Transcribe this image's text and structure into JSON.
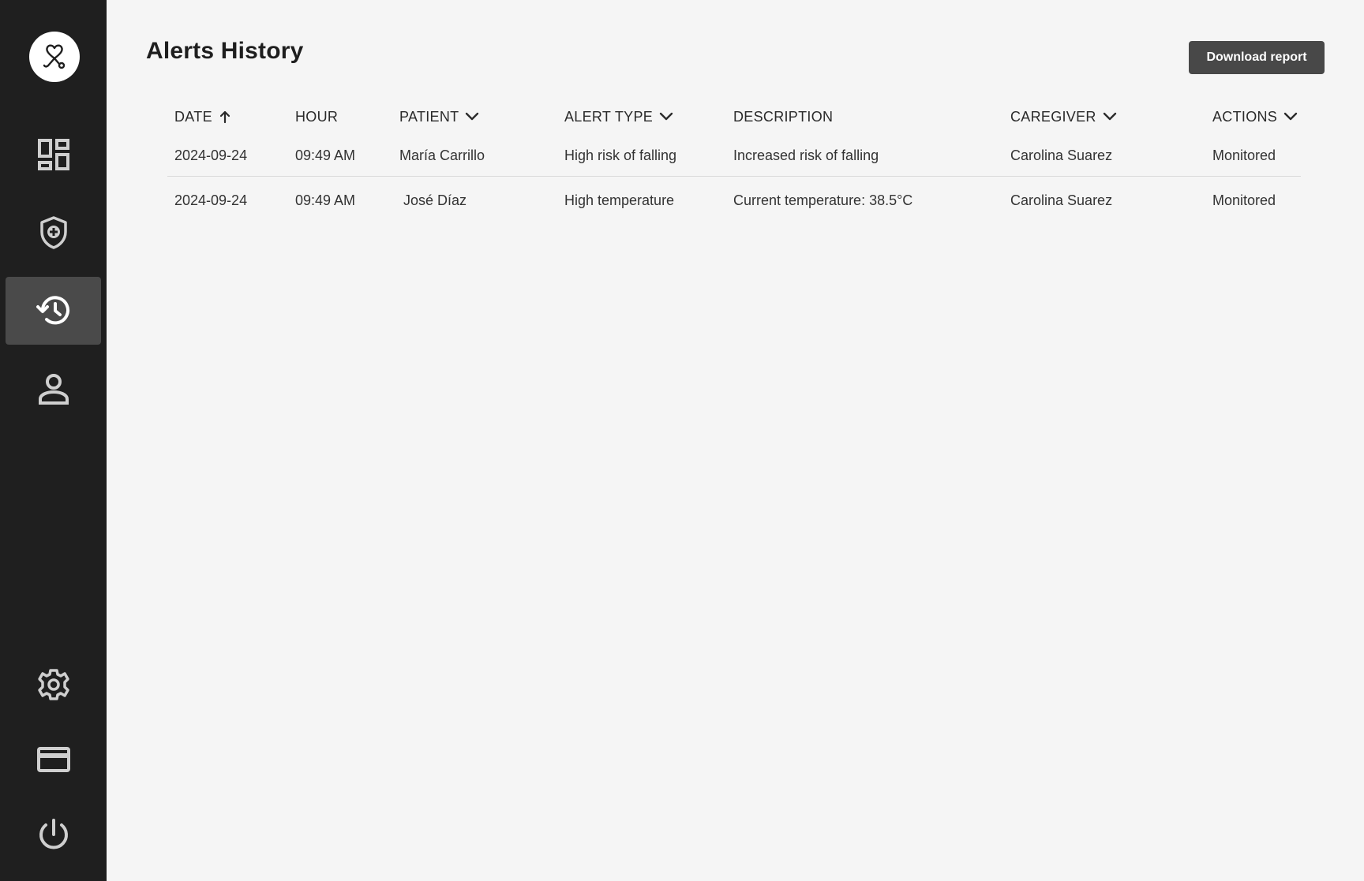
{
  "sidebar": {
    "items": [
      {
        "icon": "dashboard-icon",
        "active": false
      },
      {
        "icon": "shield-plus-icon",
        "active": false
      },
      {
        "icon": "history-icon",
        "active": true
      },
      {
        "icon": "person-icon",
        "active": false
      },
      {
        "icon": "gear-icon",
        "active": false
      },
      {
        "icon": "credit-card-icon",
        "active": false
      },
      {
        "icon": "power-icon",
        "active": false
      }
    ]
  },
  "header": {
    "title": "Alerts History",
    "download_label": "Download report"
  },
  "table": {
    "columns": [
      {
        "label": "DATE",
        "indicator": "arrow-up"
      },
      {
        "label": "HOUR",
        "indicator": "none"
      },
      {
        "label": "PATIENT",
        "indicator": "chevron-down"
      },
      {
        "label": "ALERT TYPE",
        "indicator": "chevron-down"
      },
      {
        "label": "DESCRIPTION",
        "indicator": "none"
      },
      {
        "label": "CAREGIVER",
        "indicator": "chevron-down"
      },
      {
        "label": "ACTIONS",
        "indicator": "chevron-down"
      }
    ],
    "rows": [
      [
        "2024-09-24",
        "09:49 AM",
        "María Carrillo",
        "High risk of falling",
        "Increased risk of falling",
        "Carolina Suarez",
        "Monitored"
      ],
      [
        "2024-09-24",
        "09:49 AM",
        "José Díaz",
        "High temperature",
        "Current temperature: 38.5°C",
        "Carolina Suarez",
        "Monitored"
      ]
    ]
  },
  "colors": {
    "sidebar_bg": "#1f1f1f",
    "sidebar_active": "#4a4a4a",
    "page_bg": "#f5f5f5",
    "button_bg": "#484848",
    "icon_color": "#cfcfcf"
  }
}
